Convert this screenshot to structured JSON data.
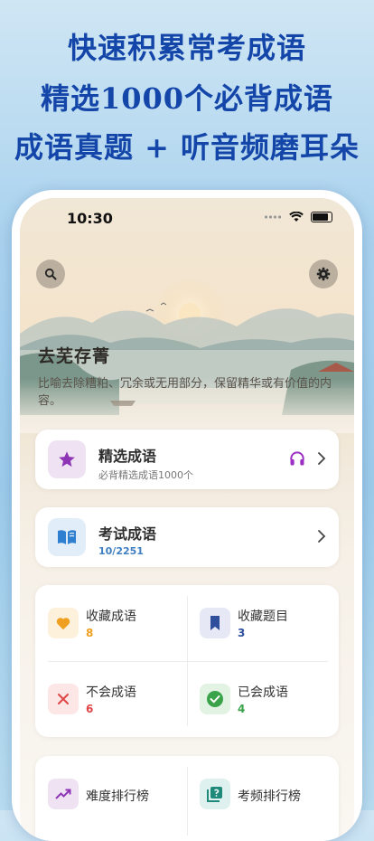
{
  "promo": {
    "line1": "快速积累常考成语",
    "line2": "精选1000个必背成语",
    "line3": "成语真题 + 听音频磨耳朵"
  },
  "status": {
    "time": "10:30"
  },
  "header": {
    "search_icon": "search-icon",
    "settings_icon": "gear-icon"
  },
  "idiom": {
    "title": "去芜存菁",
    "description": "比喻去除糟粕、冗余或无用部分，保留精华或有价值的内容。"
  },
  "featured": {
    "title": "精选成语",
    "subtitle": "必背精选成语1000个",
    "icon": "star-icon",
    "audio_icon": "headphones-icon",
    "colors": {
      "icon_bg": "#efe3f3",
      "icon": "#8e35b5",
      "audio": "#9b2fc4"
    }
  },
  "exam": {
    "title": "考试成语",
    "progress": "10/2251",
    "icon": "open-book-icon",
    "colors": {
      "icon_bg": "#e1eefa",
      "icon": "#2f7fd0",
      "progress": "#3d7fc0"
    }
  },
  "collections": [
    {
      "label": "收藏成语",
      "count": "8",
      "icon": "heart-icon",
      "color": "#f0a020",
      "bg": "#fdf1dc"
    },
    {
      "label": "收藏题目",
      "count": "3",
      "icon": "bookmark-icon",
      "color": "#2f4f9c",
      "bg": "#e6e9f5"
    },
    {
      "label": "不会成语",
      "count": "6",
      "icon": "close-icon",
      "color": "#e04646",
      "bg": "#fde6e6"
    },
    {
      "label": "已会成语",
      "count": "4",
      "icon": "check-circle-icon",
      "color": "#3aa34a",
      "bg": "#e2f3e4"
    }
  ],
  "rankings": [
    {
      "label": "难度排行榜",
      "icon": "trending-up-icon",
      "color": "#8e35b5",
      "bg": "#efe3f3"
    },
    {
      "label": "考频排行榜",
      "icon": "quiz-icon",
      "color": "#1f8a7a",
      "bg": "#dff1ee"
    }
  ]
}
